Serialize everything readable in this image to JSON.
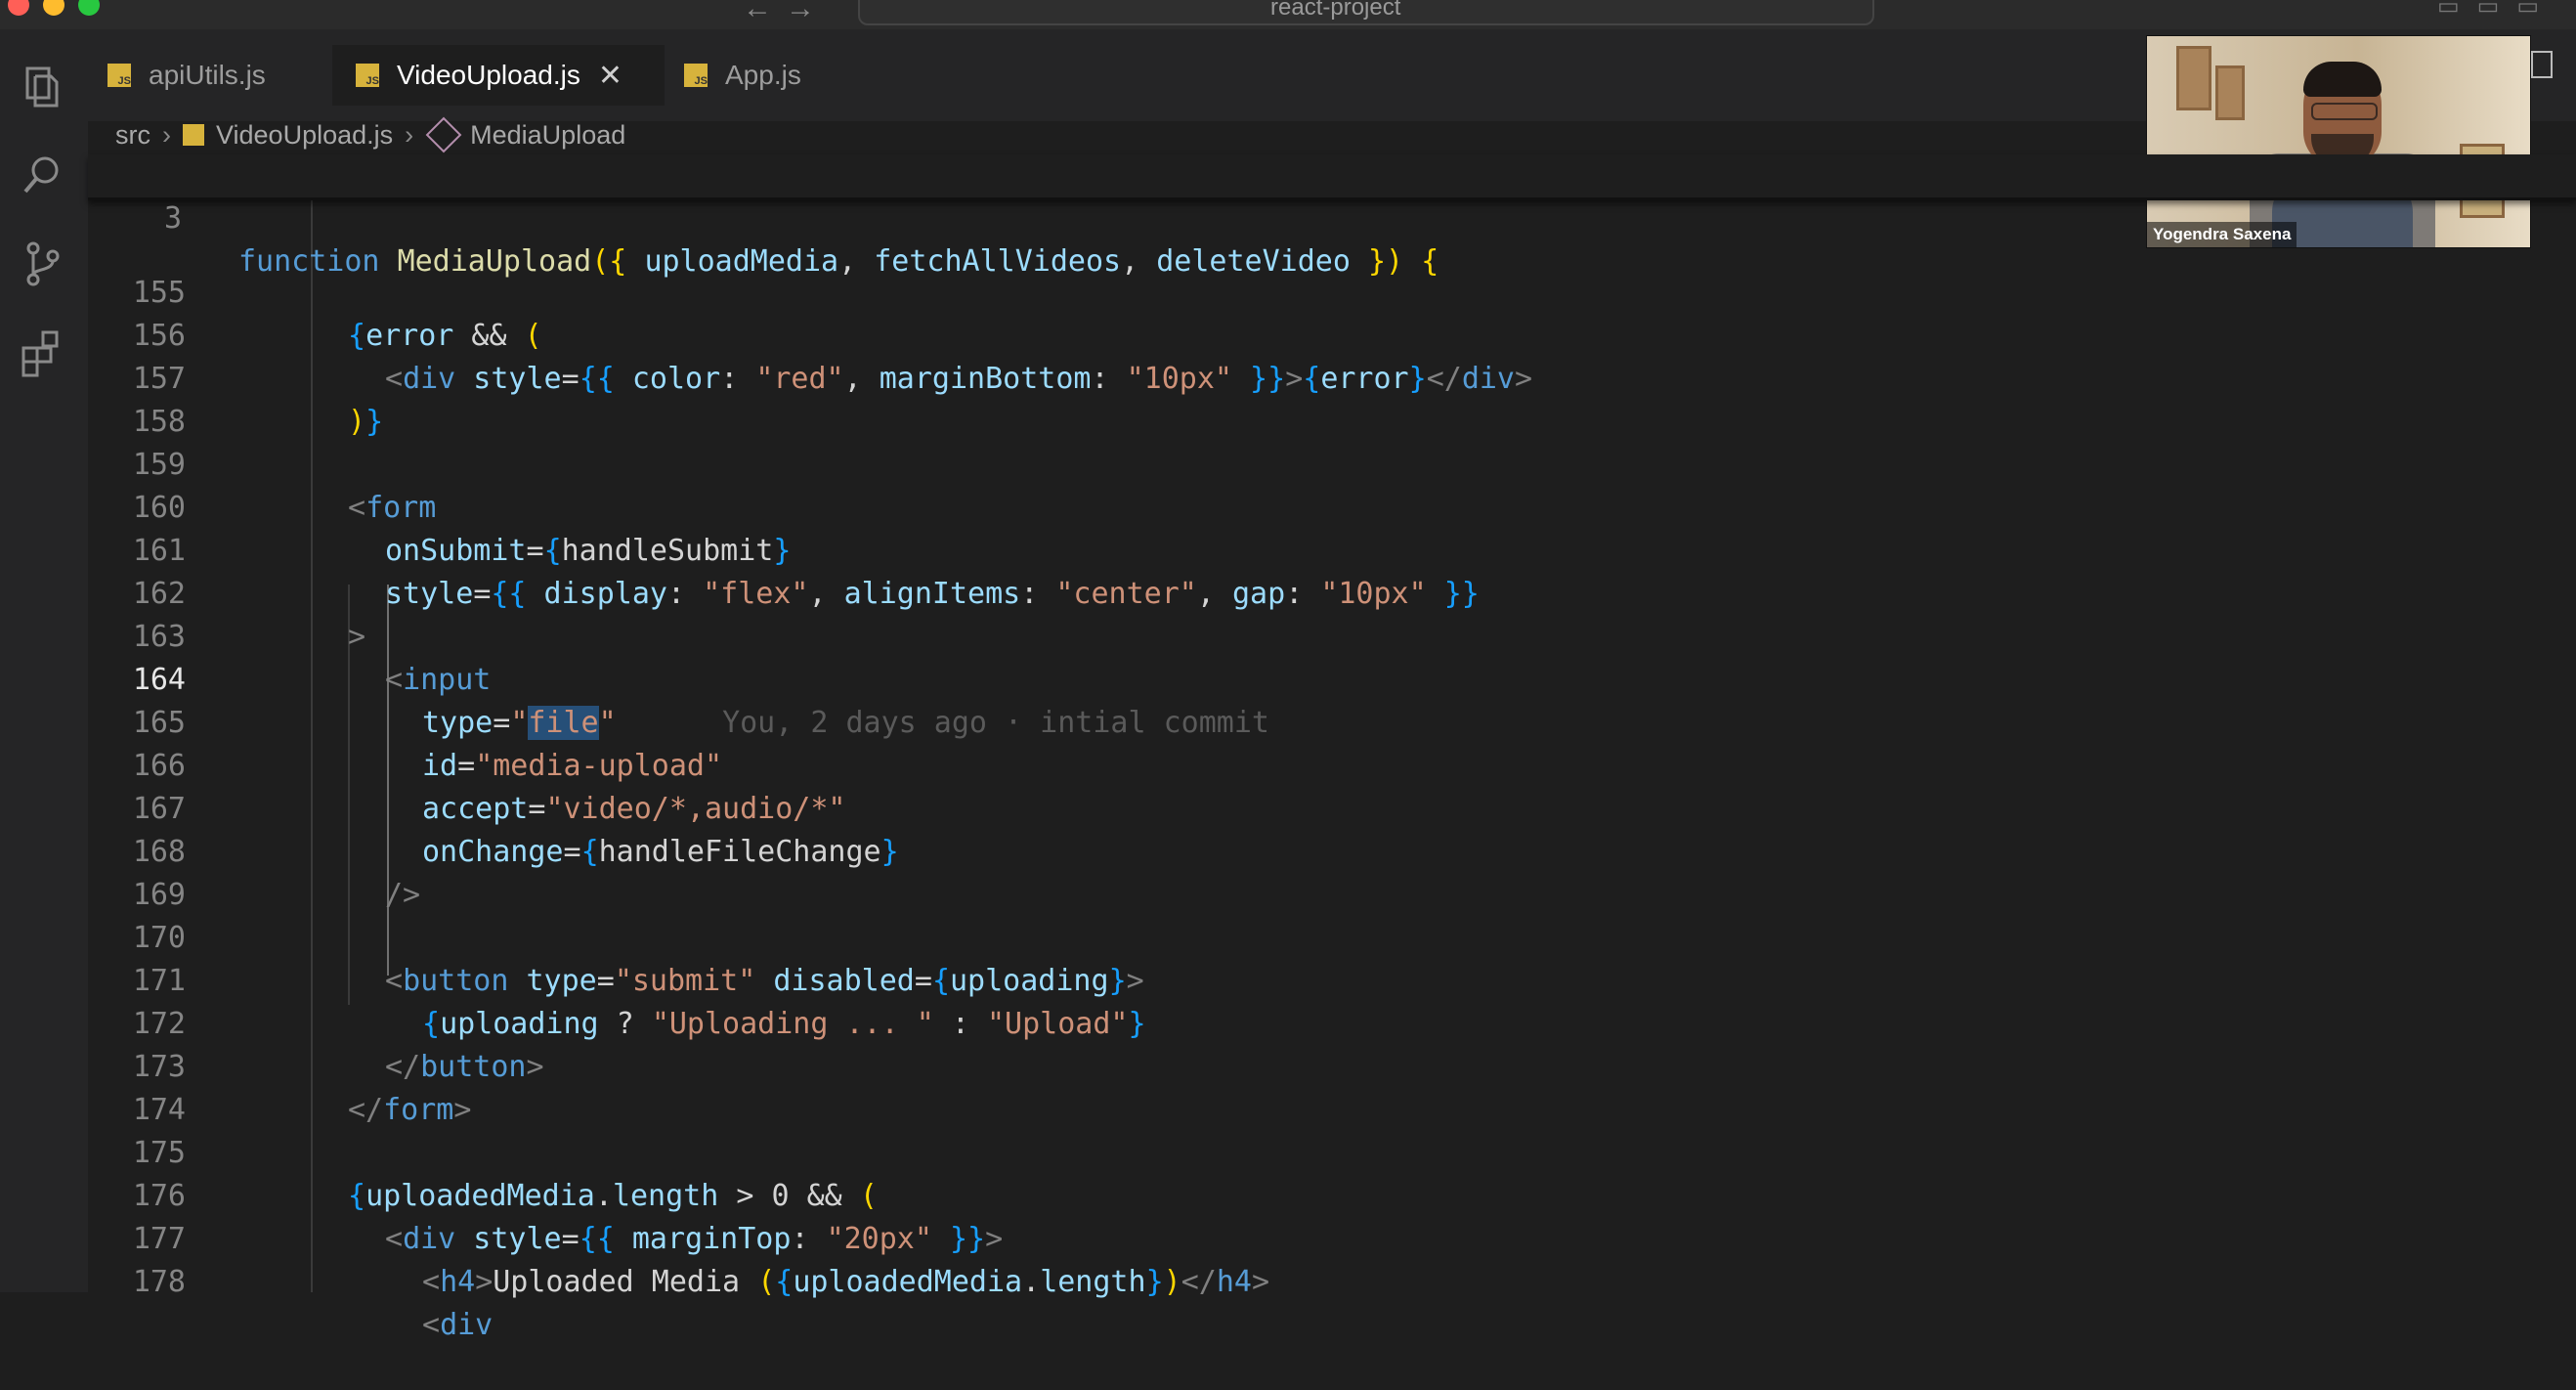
{
  "window": {
    "title": "react-project"
  },
  "tabs": [
    {
      "label": "apiUtils.js",
      "active": false
    },
    {
      "label": "VideoUpload.js",
      "active": true,
      "close": "✕"
    },
    {
      "label": "App.js",
      "active": false
    }
  ],
  "breadcrumb": {
    "folder": "src",
    "file": "VideoUpload.js",
    "symbol": "MediaUpload"
  },
  "sticky": {
    "line_no": "3",
    "kw": "function",
    "fn": "MediaUpload",
    "open": "({",
    "p1": "uploadMedia",
    "p2": "fetchAllVideos",
    "p3": "deleteVideo",
    "close": "})",
    "brace": "{"
  },
  "lines": {
    "n155": "155",
    "n156": "156",
    "n157": "157",
    "n158": "158",
    "n159": "159",
    "n160": "160",
    "n161": "161",
    "n162": "162",
    "n163": "163",
    "n164": "164",
    "n165": "165",
    "n166": "166",
    "n167": "167",
    "n168": "168",
    "n169": "169",
    "n170": "170",
    "n171": "171",
    "n172": "172",
    "n173": "173",
    "n174": "174",
    "n175": "175",
    "n176": "176",
    "n177": "177",
    "n178": "178"
  },
  "code": {
    "l155": {
      "b1": "{",
      "v": "error",
      "op": " && ",
      "p": "("
    },
    "l156": {
      "lt": "<",
      "tag": "div",
      "attr": " style",
      "eq": "=",
      "b1": "{{",
      "k1": " color",
      "c1": ": ",
      "s1": "\"red\"",
      "cm": ", ",
      "k2": "marginBottom",
      "c2": ": ",
      "s2": "\"10px\"",
      "b2": " }}",
      "gt": ">",
      "b3": "{",
      "v": "error",
      "b4": "}",
      "end": "</",
      "tag2": "div",
      "gt2": ">"
    },
    "l157": {
      "p": ")",
      "b": "}"
    },
    "l159": {
      "lt": "<",
      "tag": "form"
    },
    "l160": {
      "attr": "onSubmit",
      "eq": "=",
      "b1": "{",
      "v": "handleSubmit",
      "b2": "}"
    },
    "l161": {
      "attr": "style",
      "eq": "=",
      "b1": "{{",
      "k1": " display",
      "c1": ": ",
      "s1": "\"flex\"",
      "cm1": ", ",
      "k2": "alignItems",
      "c2": ": ",
      "s2": "\"center\"",
      "cm2": ", ",
      "k3": "gap",
      "c3": ": ",
      "s3": "\"10px\"",
      "b2": " }}"
    },
    "l162": {
      "gt": ">"
    },
    "l163": {
      "lt": "<",
      "tag": "input"
    },
    "l164": {
      "attr": "type",
      "eq": "=",
      "q1": "\"",
      "val": "file",
      "q2": "\"",
      "blame": "You, 2 days ago · intial commit"
    },
    "l165": {
      "attr": "id",
      "eq": "=",
      "s": "\"media-upload\""
    },
    "l166": {
      "attr": "accept",
      "eq": "=",
      "s": "\"video/*,audio/*\""
    },
    "l167": {
      "attr": "onChange",
      "eq": "=",
      "b1": "{",
      "v": "handleFileChange",
      "b2": "}"
    },
    "l168": {
      "end": "/>"
    },
    "l170": {
      "lt": "<",
      "tag": "button",
      "a1": " type",
      "eq1": "=",
      "s1": "\"submit\"",
      "a2": " disabled",
      "eq2": "=",
      "b1": "{",
      "v": "uploading",
      "b2": "}",
      "gt": ">"
    },
    "l171": {
      "b1": "{",
      "v": "uploading",
      "q": " ? ",
      "s1": "\"Uploading ... \"",
      "c": " : ",
      "s2": "\"Upload\"",
      "b2": "}"
    },
    "l172": {
      "lt": "</",
      "tag": "button",
      "gt": ">"
    },
    "l173": {
      "lt": "</",
      "tag": "form",
      "gt": ">"
    },
    "l175": {
      "b1": "{",
      "v": "uploadedMedia",
      "dot": ".",
      "prop": "length",
      "op": " > 0 && ",
      "p": "("
    },
    "l176": {
      "lt": "<",
      "tag": "div",
      "attr": " style",
      "eq": "=",
      "b1": "{{",
      "k": " marginTop",
      "c": ": ",
      "s": "\"20px\"",
      "b2": " }}",
      "gt": ">"
    },
    "l177": {
      "lt": "<",
      "tag": "h4",
      "gt": ">",
      "txt": "Uploaded Media ",
      "p1": "(",
      "b1": "{",
      "v": "uploadedMedia",
      "dot": ".",
      "prop": "length",
      "b2": "}",
      "p2": ")",
      "lt2": "</",
      "tag2": "h4",
      "gt2": ">"
    },
    "l178": {
      "lt": "<",
      "tag": "div"
    }
  },
  "webcam": {
    "name": "Yogendra Saxena"
  },
  "icons": [
    "explorer-icon",
    "search-icon",
    "source-control-icon",
    "extensions-icon",
    "js-file-icon",
    "component-icon",
    "split-editor-icon"
  ]
}
